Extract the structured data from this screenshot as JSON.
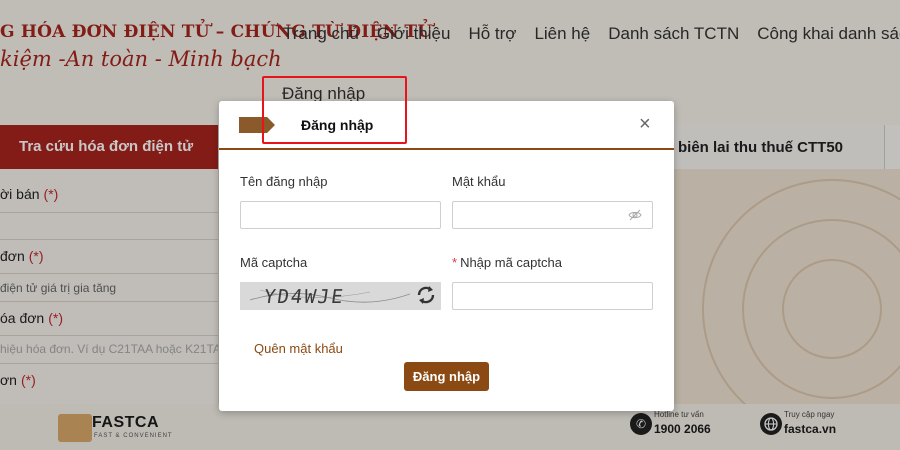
{
  "site": {
    "title": "G HÓA ĐƠN ĐIỆN TỬ – CHỨNG TỪ ĐIỆN TỬ",
    "slogan": "kiệm -An toàn - Minh bạch",
    "nav": [
      "Trang chủ",
      "Giới thiệu",
      "Hỗ trợ",
      "Liên hệ",
      "Danh sách TCTN",
      "Công khai danh sác"
    ],
    "login_link": "Đăng nhập"
  },
  "tabs": {
    "active": "Tra cứu hóa đơn điện tử",
    "other": "biên lai thu thuế CTT50"
  },
  "form": {
    "seller_label": "ời bán",
    "invoice_type_label": "đơn",
    "invoice_type_value": "điện tử giá trị gia tăng",
    "symbol_label": "óa đơn",
    "symbol_hint": "hiệu hóa đơn. Ví dụ C21TAA hoặc K21TA",
    "number_label": "ơn",
    "required_mark": "(*)"
  },
  "footer": {
    "brand": "FASTCA",
    "brand_tagline": "FAST & CONVENIENT",
    "hotline_caption": "Hotline tư vấn",
    "hotline_number": "1900 2066",
    "web_caption": "Truy cập ngay",
    "web_url": "fastca.vn"
  },
  "modal": {
    "title": "Đăng nhập",
    "close_symbol": "×",
    "username_label": "Tên đăng nhập",
    "username_value": "",
    "password_label": "Mật khẩu",
    "password_value": "",
    "captcha_label": "Mã captcha",
    "captcha_image_text": "YD4WJE",
    "captcha_input_label": "Nhập mã captcha",
    "required_star": "*",
    "captcha_input_value": "",
    "forgot_password": "Quên mật khẩu",
    "submit_label": "Đăng nhập"
  },
  "colors": {
    "brand_red": "#a8251e",
    "accent_brown": "#8b4a14",
    "highlight_red": "#e8141b"
  }
}
